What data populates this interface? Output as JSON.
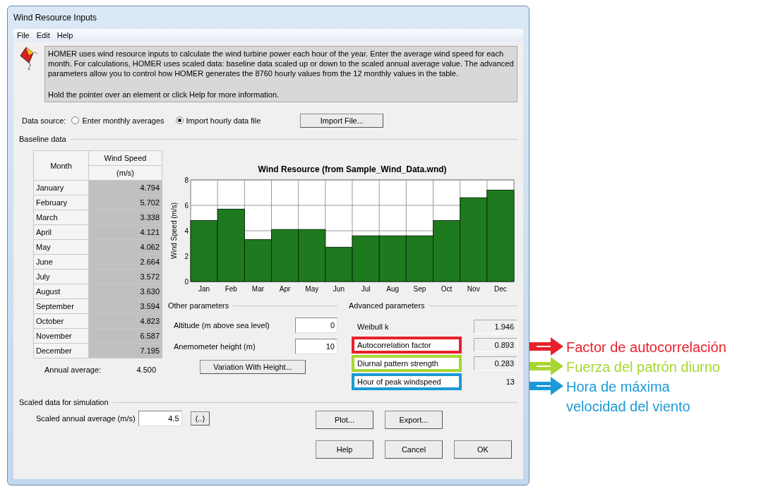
{
  "window": {
    "title": "Wind Resource Inputs"
  },
  "menu": [
    {
      "label": "File"
    },
    {
      "label": "Edit"
    },
    {
      "label": "Help"
    }
  ],
  "description": {
    "paragraphs": [
      "HOMER uses wind resource inputs to calculate the wind turbine power each hour of the year. Enter the average wind speed for each month. For calculations, HOMER uses scaled data: baseline data scaled up or down to the scaled annual average value. The advanced parameters allow you to control how HOMER generates the 8760 hourly values from the 12 monthly values in the table.",
      "Hold the pointer over an element or click Help for more information."
    ]
  },
  "data_source": {
    "label": "Data source:",
    "options": [
      {
        "label": "Enter monthly averages",
        "selected": false
      },
      {
        "label": "Import hourly data file",
        "selected": true
      }
    ],
    "button": "Import File..."
  },
  "baseline": {
    "title": "Baseline data",
    "table": {
      "columns": [
        {
          "label": "Month"
        },
        {
          "label": "Wind Speed",
          "unit": "(m/s)"
        }
      ],
      "rows": [
        {
          "month": "January",
          "speed": "4.794"
        },
        {
          "month": "February",
          "speed": "5.702"
        },
        {
          "month": "March",
          "speed": "3.338"
        },
        {
          "month": "April",
          "speed": "4.121"
        },
        {
          "month": "May",
          "speed": "4.062"
        },
        {
          "month": "June",
          "speed": "2.664"
        },
        {
          "month": "July",
          "speed": "3.572"
        },
        {
          "month": "August",
          "speed": "3.630"
        },
        {
          "month": "September",
          "speed": "3.594"
        },
        {
          "month": "October",
          "speed": "4.823"
        },
        {
          "month": "November",
          "speed": "6.587"
        },
        {
          "month": "December",
          "speed": "7.195"
        }
      ]
    },
    "annual_average": {
      "label": "Annual average:",
      "value": "4.500"
    },
    "chart_data": {
      "type": "bar",
      "title": "Wind Resource (from Sample_Wind_Data.wnd)",
      "ylabel": "Wind Speed (m/s)",
      "categories": [
        "Jan",
        "Feb",
        "Mar",
        "Apr",
        "May",
        "Jun",
        "Jul",
        "Aug",
        "Sep",
        "Oct",
        "Nov",
        "Dec"
      ],
      "values": [
        4.8,
        5.7,
        3.3,
        4.1,
        4.1,
        2.7,
        3.6,
        3.6,
        3.6,
        4.8,
        6.6,
        7.2
      ],
      "ylim": [
        0,
        8
      ],
      "yticks": [
        0,
        2,
        4,
        6,
        8
      ]
    }
  },
  "other_parameters": {
    "title": "Other parameters",
    "fields": [
      {
        "label": "Altitude (m above sea level)",
        "value": "0"
      },
      {
        "label": "Anemometer height (m)",
        "value": "10"
      }
    ],
    "button": "Variation With Height..."
  },
  "advanced_parameters": {
    "title": "Advanced parameters",
    "items": [
      {
        "label": "Weibull k",
        "value": "1.946",
        "kind": "box"
      },
      {
        "label": "Autocorrelation factor",
        "value": "0.893",
        "kind": "box",
        "color": "#e8202a"
      },
      {
        "label": "Diurnal pattern strength",
        "value": "0.283",
        "kind": "box",
        "color": "#a8d631"
      },
      {
        "label": "Hour of peak windspeed",
        "value": "13",
        "kind": "plain",
        "color": "#1a9ad6"
      }
    ]
  },
  "scaled": {
    "title": "Scaled data for simulation",
    "label": "Scaled annual average (m/s)",
    "value": "4.5",
    "button": "(..)"
  },
  "button_rows": [
    [
      "Plot...",
      "Export..."
    ],
    [
      "Help",
      "Cancel",
      "OK"
    ]
  ],
  "annotations": [
    {
      "lines": [
        "Factor de autocorrelación"
      ],
      "color": "#e8202a"
    },
    {
      "lines": [
        "Fuerza del patrón diurno"
      ],
      "color": "#a8d631"
    },
    {
      "lines": [
        "Hora de máxima",
        "velocidad del viento"
      ],
      "color": "#1a9ad6"
    }
  ]
}
